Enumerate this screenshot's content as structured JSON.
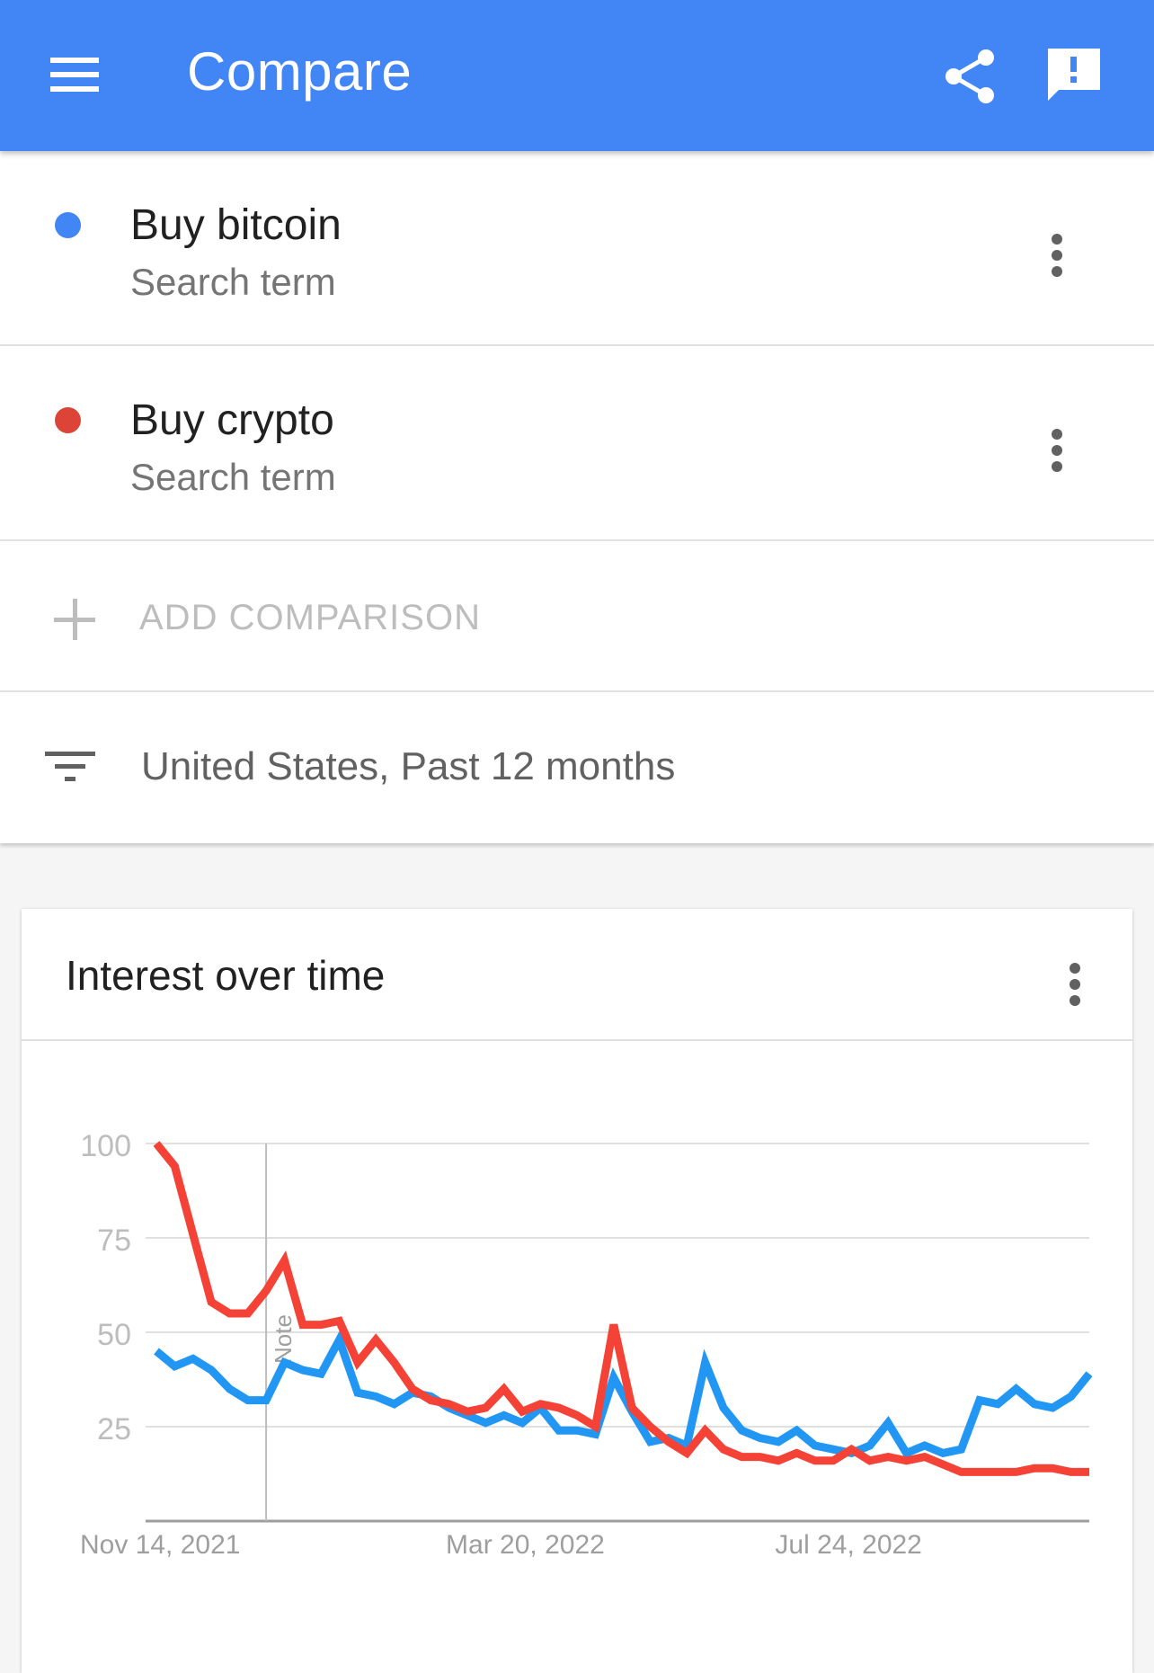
{
  "appbar": {
    "title": "Compare",
    "menu_icon": "menu-icon",
    "share_icon": "share-icon",
    "feedback_icon": "feedback-icon",
    "color": "#4285f4"
  },
  "terms": [
    {
      "name": "Buy bitcoin",
      "type": "Search term",
      "color": "#4285f4"
    },
    {
      "name": "Buy crypto",
      "type": "Search term",
      "color": "#db4437"
    }
  ],
  "add_comparison": {
    "label": "ADD COMPARISON"
  },
  "filter": {
    "label": "United States, Past 12 months"
  },
  "card": {
    "title": "Interest over time"
  },
  "chart_data": {
    "type": "line",
    "title": "Interest over time",
    "ylim": [
      0,
      100
    ],
    "y_ticks": [
      "100",
      "75",
      "50",
      "25"
    ],
    "x_ticks": [
      "Nov 14, 2021",
      "Mar 20, 2022",
      "Jul 24, 2022"
    ],
    "annotations": [
      {
        "label": "Note",
        "x_index": 6
      }
    ],
    "grid": true,
    "series": [
      {
        "name": "Buy bitcoin",
        "color": "#2196f3",
        "values": [
          45,
          41,
          43,
          40,
          35,
          32,
          32,
          42,
          40,
          39,
          48,
          34,
          33,
          31,
          34,
          33,
          30,
          28,
          26,
          28,
          26,
          30,
          24,
          24,
          23,
          38,
          29,
          21,
          22,
          20,
          42,
          30,
          24,
          22,
          21,
          24,
          20,
          19,
          18,
          20,
          26,
          18,
          20,
          18,
          19,
          32,
          31,
          35,
          31,
          30,
          33,
          39
        ]
      },
      {
        "name": "Buy crypto",
        "color": "#f44336",
        "values": [
          100,
          94,
          76,
          58,
          55,
          55,
          61,
          69,
          52,
          52,
          53,
          42,
          48,
          42,
          35,
          32,
          31,
          29,
          30,
          35,
          29,
          31,
          30,
          28,
          25,
          52,
          30,
          25,
          21,
          18,
          24,
          19,
          17,
          17,
          16,
          18,
          16,
          16,
          19,
          16,
          17,
          16,
          17,
          15,
          13,
          13,
          13,
          13,
          14,
          14,
          13,
          13
        ]
      }
    ]
  }
}
